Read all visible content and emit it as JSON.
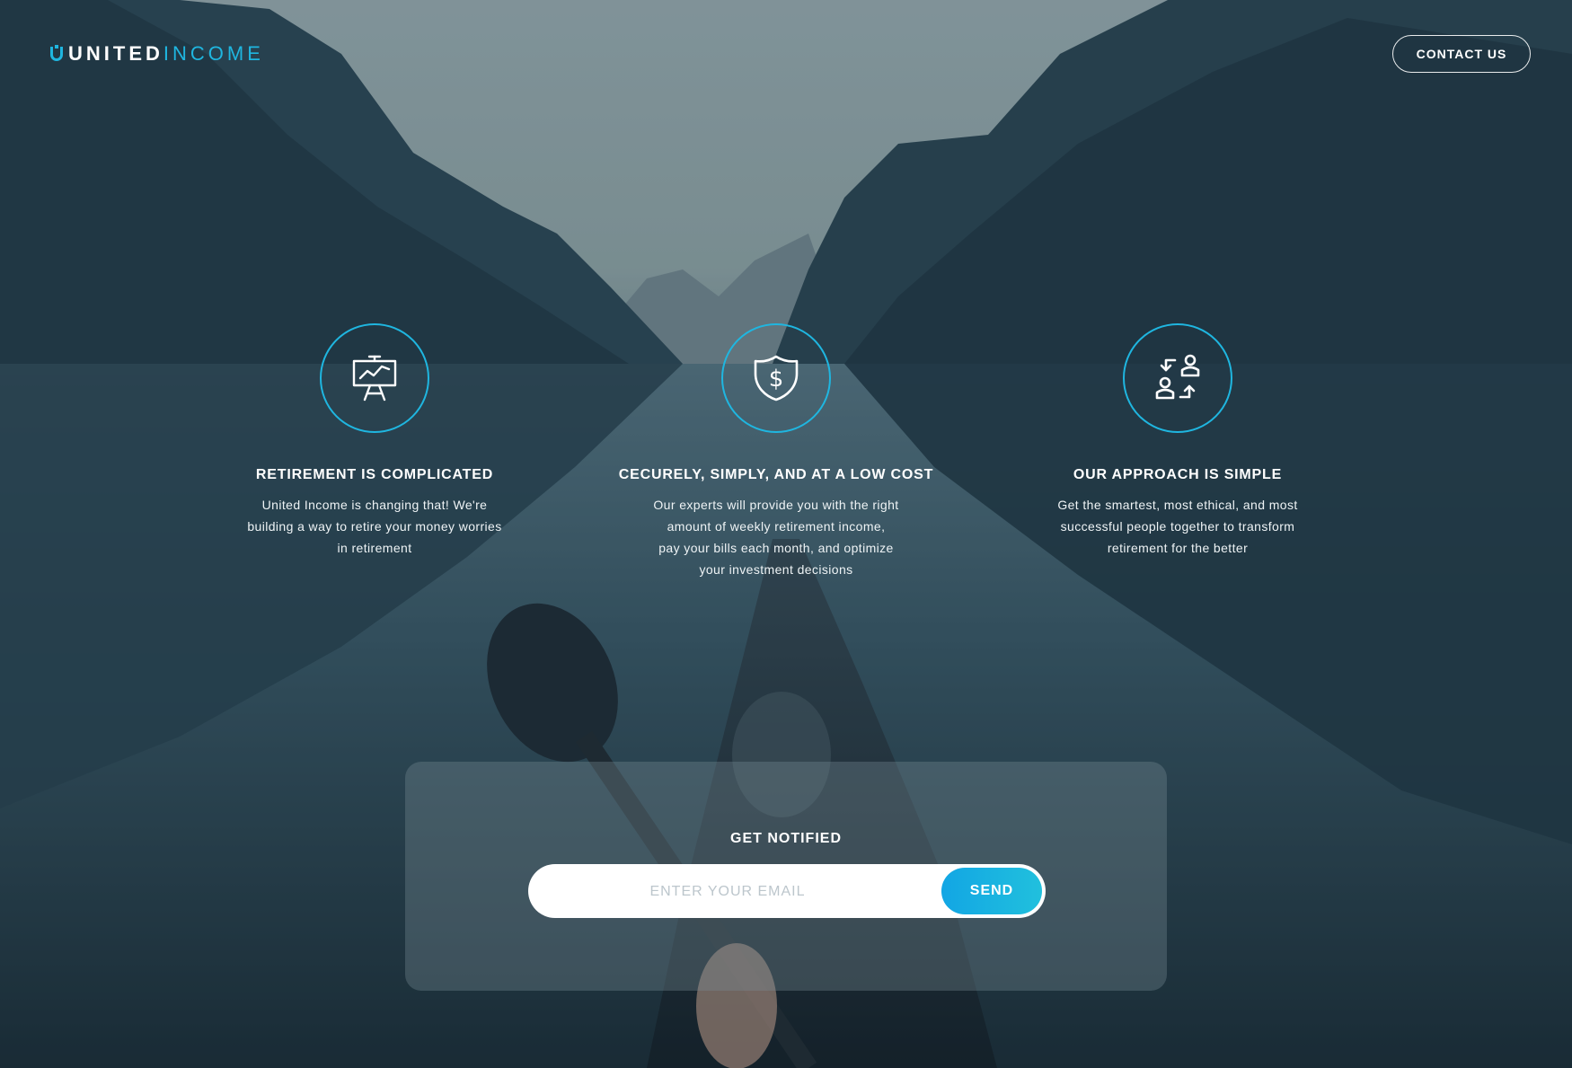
{
  "brand": {
    "name_part1": "UNITED",
    "name_part2": "INCOME",
    "accent_color": "#1fb6e0"
  },
  "header": {
    "contact_label": "CONTACT US"
  },
  "features": [
    {
      "icon": "presentation-chart-icon",
      "title": "RETIREMENT IS COMPLICATED",
      "text": "United Income is changing that! We're building a way to retire your money worries in retirement"
    },
    {
      "icon": "shield-dollar-icon",
      "title": "CECURELY, SIMPLY, AND AT A LOW COST",
      "text_line1": "Our experts will provide you with the right amount of weekly retirement income,",
      "text_line2": "pay your bills each month, and optimize your investment decisions"
    },
    {
      "icon": "people-exchange-icon",
      "title": "OUR APPROACH IS SIMPLE",
      "text": "Get the smartest, most ethical, and most successful people together to transform retirement for the better"
    }
  ],
  "notify": {
    "title": "GET NOTIFIED",
    "email_placeholder": "ENTER YOUR EMAIL",
    "send_label": "SEND",
    "send_color": "#12a6e4"
  }
}
